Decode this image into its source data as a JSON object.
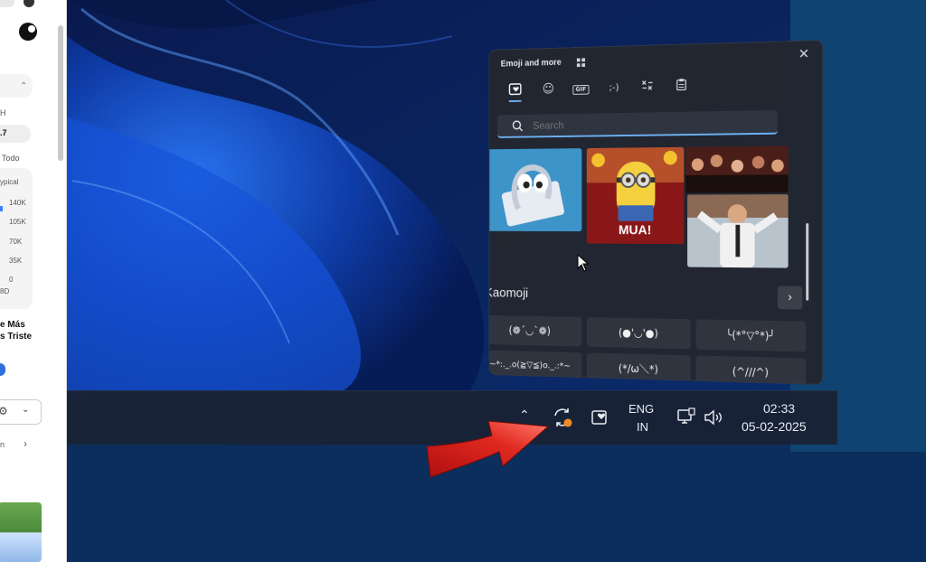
{
  "left_panel": {
    "letter_h": "H",
    "value_7": ".7",
    "todo": "Todo",
    "typical": "ypical",
    "axis_labels": [
      "140K",
      "105K",
      "70K",
      "35K",
      "0"
    ],
    "axis_foot": "8D",
    "headline_1": "e Más",
    "headline_2": "s Triste",
    "tab_n": "n"
  },
  "emoji_panel": {
    "title": "Emoji and more",
    "tabs": [
      "favorites-tab",
      "emoji-tab",
      "gif-tab",
      "kaomoji-tab",
      "symbols-tab",
      "clipboard-tab"
    ],
    "gif_tab_label": "GIF",
    "kaomoji_tab_label": ";-)",
    "search_placeholder": "Search",
    "gif_caption": "MUA!",
    "section_title": "Kaomoji",
    "kaomoji": [
      "(❁´◡`❁)",
      "(●'◡'●)",
      "╰(*°▽°*)╯",
      "~*:._.o(≧▽≦)o._.:*~",
      "(*/ω＼*)",
      "(^///^)"
    ]
  },
  "taskbar": {
    "language_line1": "ENG",
    "language_line2": "IN",
    "time": "02:33",
    "date": "05-02-2025"
  },
  "colors": {
    "accent": "#6eb0f0",
    "arrow": "#e0281e",
    "update_badge": "#f08a24"
  }
}
